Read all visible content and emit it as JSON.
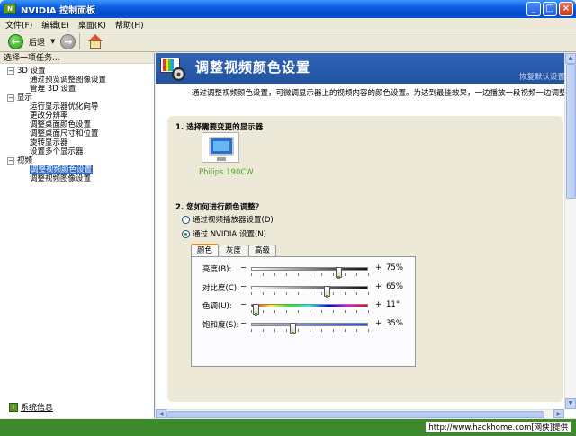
{
  "window": {
    "title": "NVIDIA 控制面板",
    "app_icon": "nvidia-logo-icon"
  },
  "menu": [
    "文件(F)",
    "编辑(E)",
    "桌面(K)",
    "帮助(H)"
  ],
  "toolbar": {
    "back_label": "后退"
  },
  "left": {
    "header": "选择一项任务...",
    "tree": [
      {
        "category": "3D 设置",
        "items": [
          "通过预览调整图像设置",
          "管理 3D 设置"
        ]
      },
      {
        "category": "显示",
        "items": [
          "运行显示器优化向导",
          "更改分辨率",
          "调整桌面颜色设置",
          "调整桌面尺寸和位置",
          "旋转显示器",
          "设置多个显示器"
        ]
      },
      {
        "category": "视频",
        "items": [
          "调整视频颜色设置",
          "调整视频图像设置"
        ]
      }
    ],
    "selected_item": "调整视频颜色设置",
    "sysinfo": "系统信息"
  },
  "page": {
    "title": "调整视频颜色设置",
    "restore": "恢复默认设置",
    "description": "通过调整视频颜色设置，可微调显示器上的视频内容的颜色设置。为达到最佳效果，一边播放一段视频一边调整，观察",
    "section1": "1. 选择需要变更的显示器",
    "monitor_label": "Philips 190CW",
    "section2": "2. 您如何进行颜色调整？",
    "radio1": "通过视频播放器设置(D)",
    "radio2": "通过 NVIDIA 设置(N)",
    "radio_selected": 2,
    "tabs": [
      "颜色",
      "灰度",
      "高级"
    ],
    "active_tab": 0,
    "sliders": [
      {
        "label": "亮度(B):",
        "value": "75%",
        "fraction": 0.75
      },
      {
        "label": "对比度(C):",
        "value": "65%",
        "fraction": 0.65
      },
      {
        "label": "色调(U):",
        "value": "11°",
        "fraction": 0.03
      },
      {
        "label": "饱和度(S):",
        "value": "35%",
        "fraction": 0.35
      }
    ]
  },
  "status": {
    "text": "http://www.hackhome.com[网侠]提供"
  }
}
